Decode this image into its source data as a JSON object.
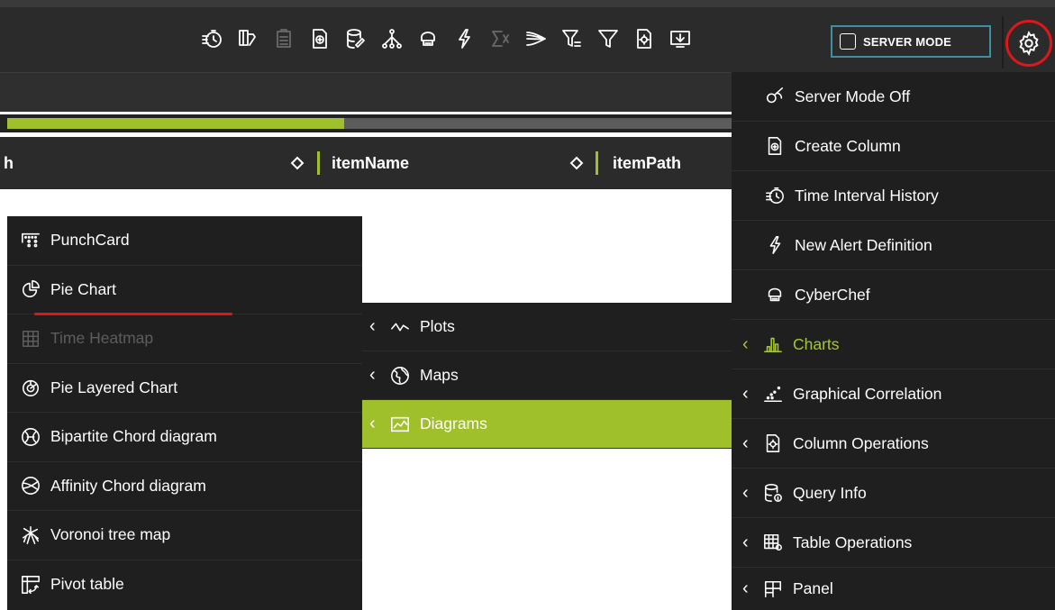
{
  "toolbar": {
    "icons": [
      "time-interval-icon",
      "copy-columns-icon",
      "clipboard-icon",
      "create-column-icon",
      "query-edit-icon",
      "hierarchy-icon",
      "cyberchef-icon",
      "alert-icon",
      "aggregate-icon",
      "streams-icon",
      "filter-or-icon",
      "filter-icon",
      "column-operations-icon",
      "download-icon"
    ],
    "server_mode_label": "SERVER MODE",
    "accent_color": "#9fc02b",
    "highlight_color": "#e0161b"
  },
  "progress": {
    "value": 0.46
  },
  "table": {
    "headers": [
      "h",
      "itemName",
      "itemPath"
    ]
  },
  "left_menu": {
    "items": [
      {
        "label": "PunchCard",
        "icon": "punchcard-icon",
        "enabled": true
      },
      {
        "label": "Pie Chart",
        "icon": "pie-chart-icon",
        "enabled": true
      },
      {
        "label": "Time Heatmap",
        "icon": "time-heatmap-icon",
        "enabled": false
      },
      {
        "label": "Pie Layered Chart",
        "icon": "pie-layered-icon",
        "enabled": true
      },
      {
        "label": "Bipartite Chord diagram",
        "icon": "bipartite-chord-icon",
        "enabled": true
      },
      {
        "label": "Affinity Chord diagram",
        "icon": "affinity-chord-icon",
        "enabled": true
      },
      {
        "label": "Voronoi tree map",
        "icon": "voronoi-icon",
        "enabled": true
      },
      {
        "label": "Pivot table",
        "icon": "pivot-table-icon",
        "enabled": true
      }
    ]
  },
  "mid_menu": {
    "items": [
      {
        "label": "Plots",
        "icon": "plots-icon",
        "active": false
      },
      {
        "label": "Maps",
        "icon": "globe-icon",
        "active": false
      },
      {
        "label": "Diagrams",
        "icon": "diagram-icon",
        "active": true
      }
    ]
  },
  "right_menu": {
    "items": [
      {
        "label": "Server Mode Off",
        "icon": "server-mode-off-icon",
        "submenu": false
      },
      {
        "label": "Create Column",
        "icon": "create-column-icon",
        "submenu": false
      },
      {
        "label": "Time Interval History",
        "icon": "time-interval-icon",
        "submenu": false
      },
      {
        "label": "New Alert Definition",
        "icon": "alert-icon",
        "submenu": false
      },
      {
        "label": "CyberChef",
        "icon": "cyberchef-icon",
        "submenu": false
      },
      {
        "label": "Charts",
        "icon": "charts-icon",
        "submenu": true,
        "active": true
      },
      {
        "label": "Graphical Correlation",
        "icon": "scatter-icon",
        "submenu": true
      },
      {
        "label": "Column Operations",
        "icon": "column-operations-icon",
        "submenu": true
      },
      {
        "label": "Query Info",
        "icon": "query-info-icon",
        "submenu": true
      },
      {
        "label": "Table Operations",
        "icon": "table-operations-icon",
        "submenu": true
      },
      {
        "label": "Panel",
        "icon": "panel-icon",
        "submenu": true
      }
    ]
  }
}
